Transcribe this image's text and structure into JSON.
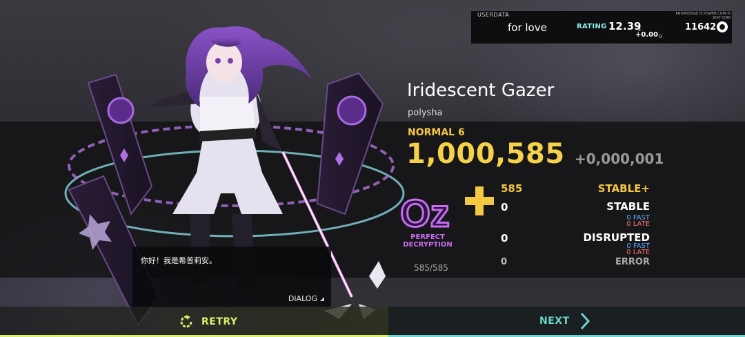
{
  "userdata": {
    "label": "USERDATA",
    "username": "for love",
    "rating_label": "RATING",
    "rating": "12.39",
    "rating_sub": "3",
    "rating_delta": "+0.00",
    "rating_delta_sub": "0",
    "coins": "11642",
    "motto": "KNOWLEDGE IS POWER COIN IS JUST COIN"
  },
  "song": {
    "title": "Iridescent Gazer",
    "artist": "polysha",
    "difficulty": "NORMAL 6",
    "score": "1,000,585",
    "score_delta": "+0,000,001"
  },
  "rank": {
    "grade": "Oz",
    "label_line1": "PERFECT",
    "label_line2": "DECRYPTION",
    "plus": "+"
  },
  "judgements": {
    "stable_plus": {
      "count": "585",
      "name": "STABLE+"
    },
    "stable": {
      "count": "0",
      "name": "STABLE",
      "fast": "0 FAST",
      "late": "0 LATE"
    },
    "disrupted": {
      "count": "0",
      "name": "DISRUPTED",
      "fast": "0 FAST",
      "late": "0 LATE"
    },
    "error": {
      "count": "0",
      "name": "ERROR"
    },
    "total": "585/585"
  },
  "dialog": {
    "text": "你好！我是希普莉安。",
    "button": "DIALOG"
  },
  "nav": {
    "retry": "RETRY",
    "next": "NEXT"
  },
  "colors": {
    "gold": "#f5c842",
    "purple": "#c86df0",
    "retry_accent": "#d9f06a",
    "next_accent": "#6ad6cf",
    "rating_accent": "#8ff0e6"
  },
  "icons": {
    "coin": "coin-icon",
    "retry": "retry-icon",
    "next": "chevron-right-icon",
    "dialog": "corner-triangle-icon"
  }
}
